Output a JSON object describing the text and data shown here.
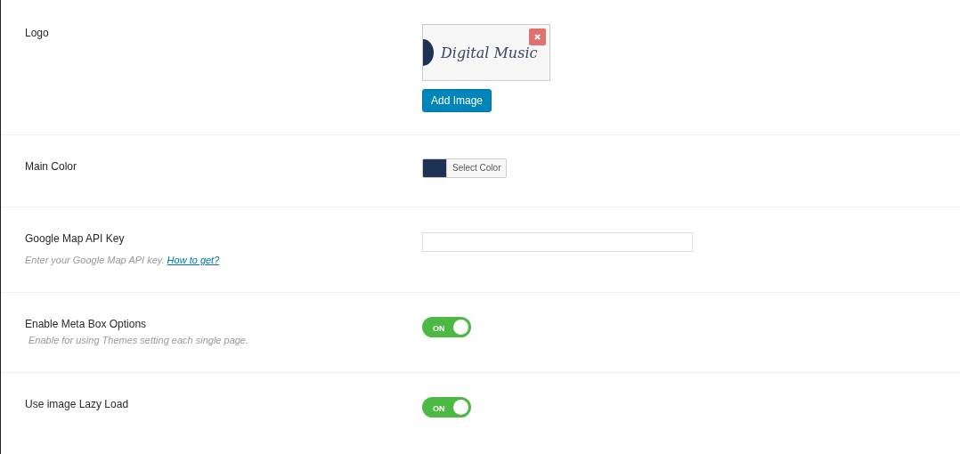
{
  "rows": [
    {
      "kind": "image",
      "label": "Logo",
      "logo_text": "Digital Music",
      "button": "Add Image"
    },
    {
      "kind": "color",
      "label": "Main Color",
      "color": "#1e3256",
      "button": "Select Color"
    },
    {
      "kind": "text",
      "label": "Google Map API Key",
      "description": "Enter your Google Map API key.",
      "link": "How to get?"
    },
    {
      "kind": "switch",
      "label": "Enable Meta Box Options",
      "description": "Enable for using Themes setting each single page.",
      "on": true,
      "switch_label": "ON"
    },
    {
      "kind": "switch",
      "label": "Use image Lazy Load",
      "on": true,
      "switch_label": "ON"
    }
  ]
}
